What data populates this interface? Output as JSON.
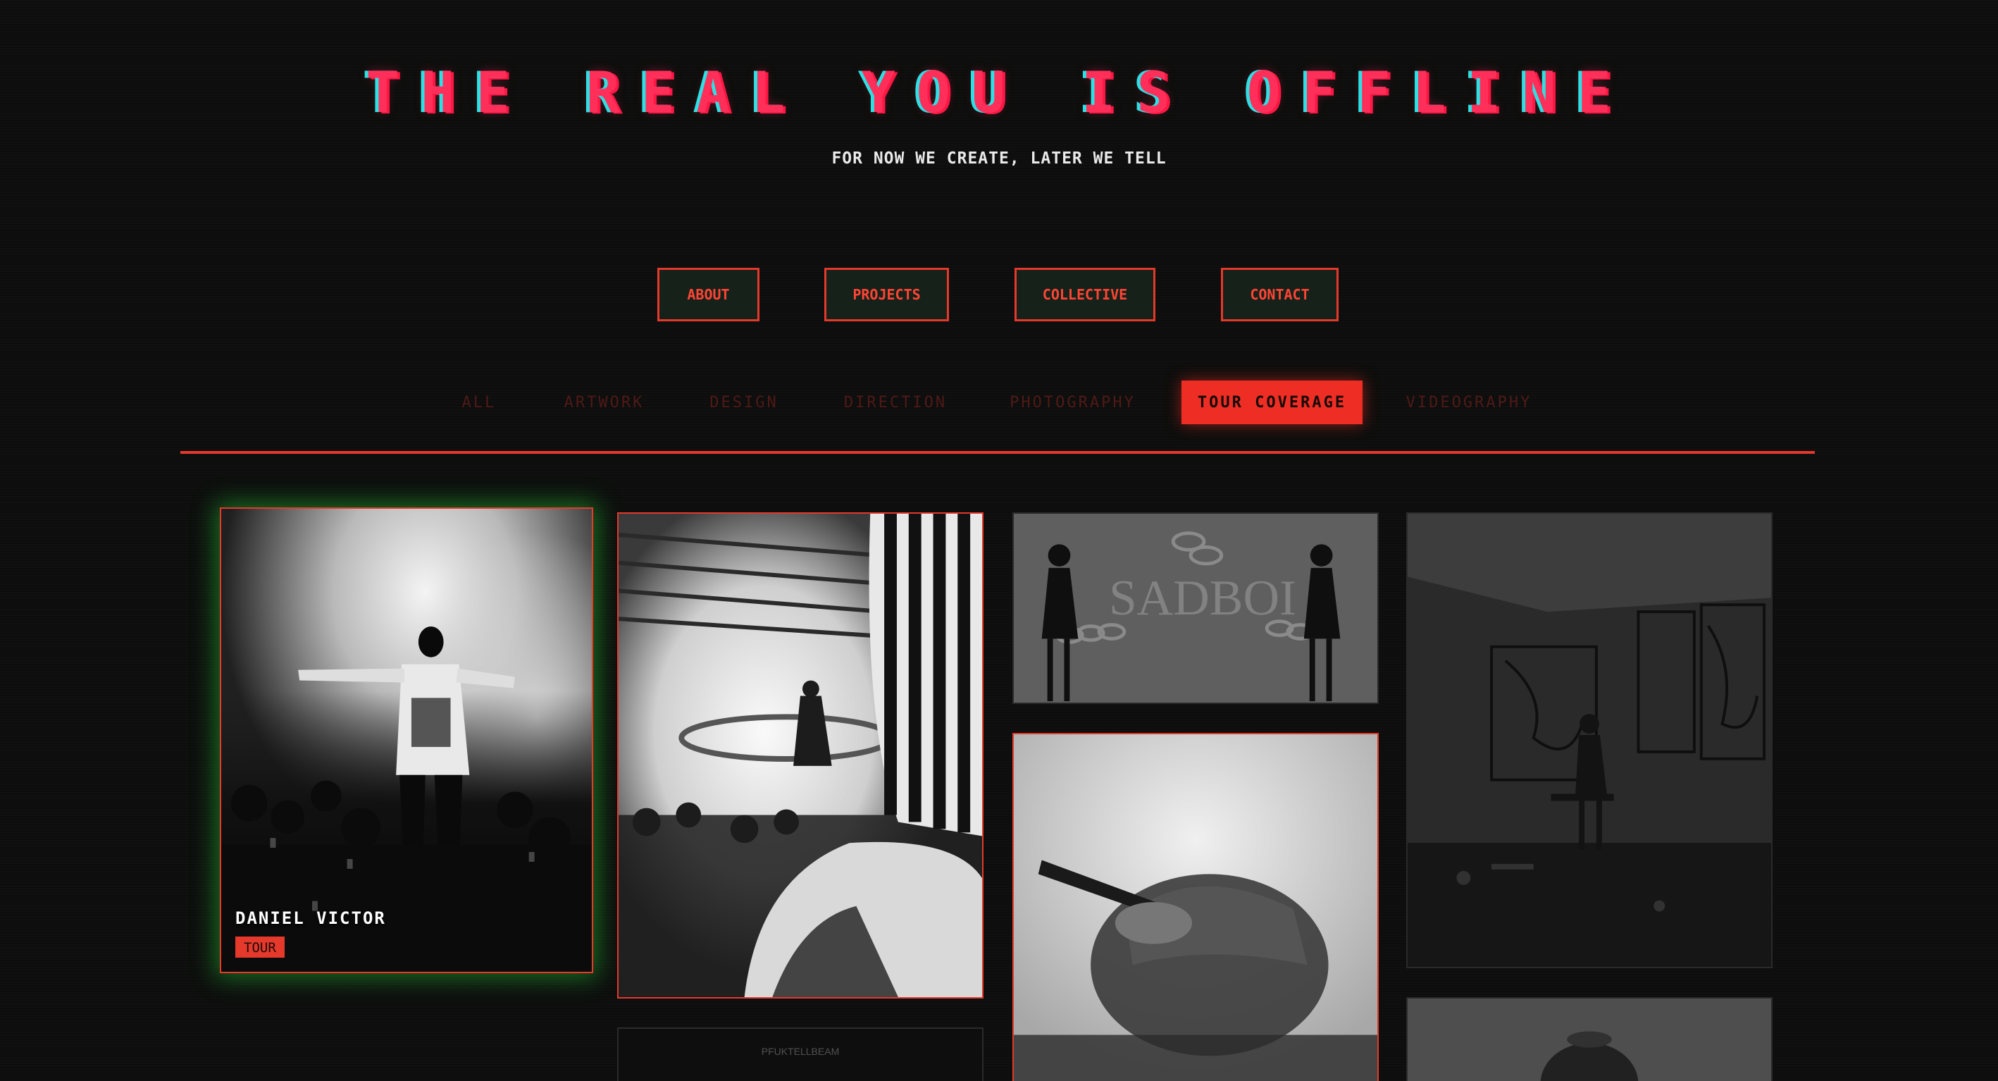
{
  "header": {
    "title": "THE REAL YOU IS OFFLINE",
    "tagline": "FOR NOW WE CREATE, LATER WE TELL"
  },
  "main_nav": {
    "items": [
      {
        "label": "ABOUT"
      },
      {
        "label": "PROJECTS"
      },
      {
        "label": "COLLECTIVE"
      },
      {
        "label": "CONTACT"
      }
    ]
  },
  "filters": {
    "active": "TOUR COVERAGE",
    "items": [
      {
        "label": "ALL"
      },
      {
        "label": "ARTWORK"
      },
      {
        "label": "DESIGN"
      },
      {
        "label": "DIRECTION"
      },
      {
        "label": "PHOTOGRAPHY"
      },
      {
        "label": "TOUR COVERAGE"
      },
      {
        "label": "VIDEOGRAPHY"
      }
    ]
  },
  "grid": {
    "cards": [
      {
        "title": "DANIEL VICTOR",
        "tag": "TOUR",
        "image": "performer-smoke-photo",
        "hovered": true
      },
      {
        "image": "concert-crowd-photo"
      },
      {
        "image": "sadboi-chains-photo",
        "image_text": "SADBOI"
      },
      {
        "image": "artist-studio-photo"
      },
      {
        "image": "dark-poster-photo",
        "image_text": "PFUKTELLBEAM"
      },
      {
        "image": "blurred-cap-photo"
      },
      {
        "image": "portrait-photo"
      }
    ]
  },
  "colors": {
    "background": "#0c0d0c",
    "accent": "#e5392b",
    "nav_fill": "#16211a",
    "title_pink": "#ff2f5a",
    "title_cyan": "#2ce0e4",
    "hover_glow": "#28e63c",
    "inactive_tab": "#4f1a17"
  }
}
